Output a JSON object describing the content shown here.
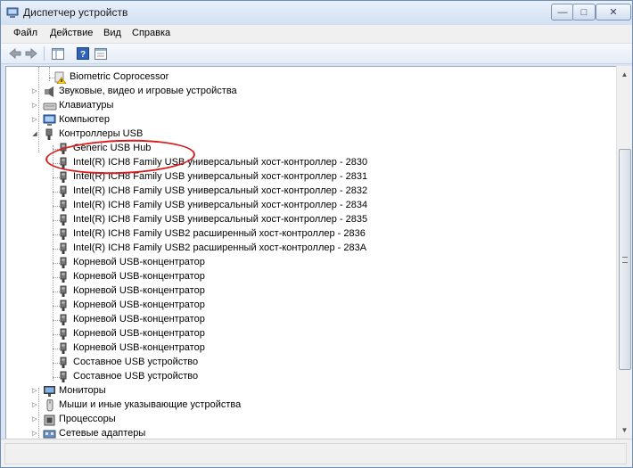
{
  "window": {
    "title": "Диспетчер устройств",
    "controls": {
      "minimize": "—",
      "maximize": "□",
      "close": "✕"
    }
  },
  "menu": [
    "Файл",
    "Действие",
    "Вид",
    "Справка"
  ],
  "toolbar": [
    "back-icon",
    "forward-icon",
    "show-hide-tree-icon",
    "help-icon",
    "properties-icon"
  ],
  "tree": {
    "rows": [
      {
        "label": "Biometric Coprocessor",
        "indent": 3,
        "expander": "",
        "icon": "warning-device-icon"
      },
      {
        "label": "Звуковые, видео и игровые устройства",
        "indent": 1,
        "expander": "▷",
        "icon": "speaker-icon"
      },
      {
        "label": "Клавиатуры",
        "indent": 1,
        "expander": "▷",
        "icon": "keyboard-icon"
      },
      {
        "label": "Компьютер",
        "indent": 1,
        "expander": "▷",
        "icon": "computer-icon"
      },
      {
        "label": "Контроллеры USB",
        "indent": 1,
        "expander": "◢",
        "icon": "usb-icon"
      },
      {
        "label": "Generic USB Hub",
        "indent": 2,
        "expander": "",
        "icon": "usb-plug-icon"
      },
      {
        "label": "Intel(R) ICH8 Family USB универсальный хост-контроллер - 2830",
        "indent": 2,
        "expander": "",
        "icon": "usb-plug-icon"
      },
      {
        "label": "Intel(R) ICH8 Family USB универсальный хост-контроллер - 2831",
        "indent": 2,
        "expander": "",
        "icon": "usb-plug-icon"
      },
      {
        "label": "Intel(R) ICH8 Family USB универсальный хост-контроллер - 2832",
        "indent": 2,
        "expander": "",
        "icon": "usb-plug-icon"
      },
      {
        "label": "Intel(R) ICH8 Family USB универсальный хост-контроллер - 2834",
        "indent": 2,
        "expander": "",
        "icon": "usb-plug-icon"
      },
      {
        "label": "Intel(R) ICH8 Family USB универсальный хост-контроллер - 2835",
        "indent": 2,
        "expander": "",
        "icon": "usb-plug-icon"
      },
      {
        "label": "Intel(R) ICH8 Family USB2 расширенный хост-контроллер - 2836",
        "indent": 2,
        "expander": "",
        "icon": "usb-plug-icon"
      },
      {
        "label": "Intel(R) ICH8 Family USB2 расширенный хост-контроллер - 283A",
        "indent": 2,
        "expander": "",
        "icon": "usb-plug-icon"
      },
      {
        "label": "Корневой USB-концентратор",
        "indent": 2,
        "expander": "",
        "icon": "usb-plug-icon"
      },
      {
        "label": "Корневой USB-концентратор",
        "indent": 2,
        "expander": "",
        "icon": "usb-plug-icon"
      },
      {
        "label": "Корневой USB-концентратор",
        "indent": 2,
        "expander": "",
        "icon": "usb-plug-icon"
      },
      {
        "label": "Корневой USB-концентратор",
        "indent": 2,
        "expander": "",
        "icon": "usb-plug-icon"
      },
      {
        "label": "Корневой USB-концентратор",
        "indent": 2,
        "expander": "",
        "icon": "usb-plug-icon"
      },
      {
        "label": "Корневой USB-концентратор",
        "indent": 2,
        "expander": "",
        "icon": "usb-plug-icon"
      },
      {
        "label": "Корневой USB-концентратор",
        "indent": 2,
        "expander": "",
        "icon": "usb-plug-icon"
      },
      {
        "label": "Составное USB устройство",
        "indent": 2,
        "expander": "",
        "icon": "usb-plug-icon"
      },
      {
        "label": "Составное USB устройство",
        "indent": 2,
        "expander": "",
        "icon": "usb-plug-icon"
      },
      {
        "label": "Мониторы",
        "indent": 1,
        "expander": "▷",
        "icon": "monitor-icon"
      },
      {
        "label": "Мыши и иные указывающие устройства",
        "indent": 1,
        "expander": "▷",
        "icon": "mouse-icon"
      },
      {
        "label": "Процессоры",
        "indent": 1,
        "expander": "▷",
        "icon": "cpu-icon"
      },
      {
        "label": "Сетевые адаптеры",
        "indent": 1,
        "expander": "▷",
        "icon": "network-icon"
      }
    ]
  },
  "annotation": {
    "highlighted_item": "Generic USB Hub",
    "color": "#d91c1c"
  }
}
